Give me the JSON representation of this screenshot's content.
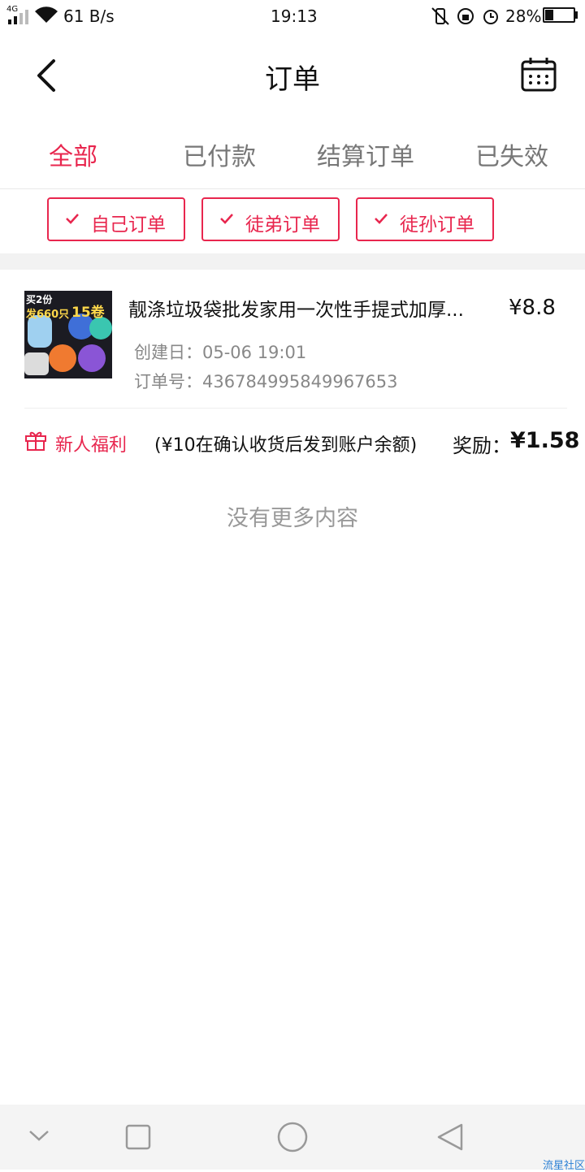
{
  "status_bar": {
    "network": "4G",
    "speed": "61 B/s",
    "time": "19:13",
    "battery_percent": "28%",
    "battery_level": 0.28
  },
  "header": {
    "title": "订单"
  },
  "tabs": [
    {
      "label": "全部",
      "active": true
    },
    {
      "label": "已付款",
      "active": false
    },
    {
      "label": "结算订单",
      "active": false
    },
    {
      "label": "已失效",
      "active": false
    }
  ],
  "filters": [
    {
      "label": "自己订单",
      "checked": true
    },
    {
      "label": "徒弟订单",
      "checked": true
    },
    {
      "label": "徒孙订单",
      "checked": true
    }
  ],
  "order": {
    "title": "靓涤垃圾袋批发家用一次性手提式加厚...",
    "price": "¥8.8",
    "created_label": "创建日：",
    "created_value": "05-06 19:01",
    "order_no_label": "订单号：",
    "order_no_value": "436784995849967653",
    "thumb_text": {
      "line1": "买2份",
      "line2": "发660只",
      "badge": "15卷"
    }
  },
  "bonus": {
    "label": "新人福利",
    "note": "(¥10在确认收货后发到账户余额)",
    "reward_label": "奖励：",
    "reward_value": "¥1.58"
  },
  "no_more": "没有更多内容",
  "watermark": "流星社区",
  "colors": {
    "accent": "#e8264e",
    "text_primary": "#111111",
    "text_secondary": "#888888"
  }
}
